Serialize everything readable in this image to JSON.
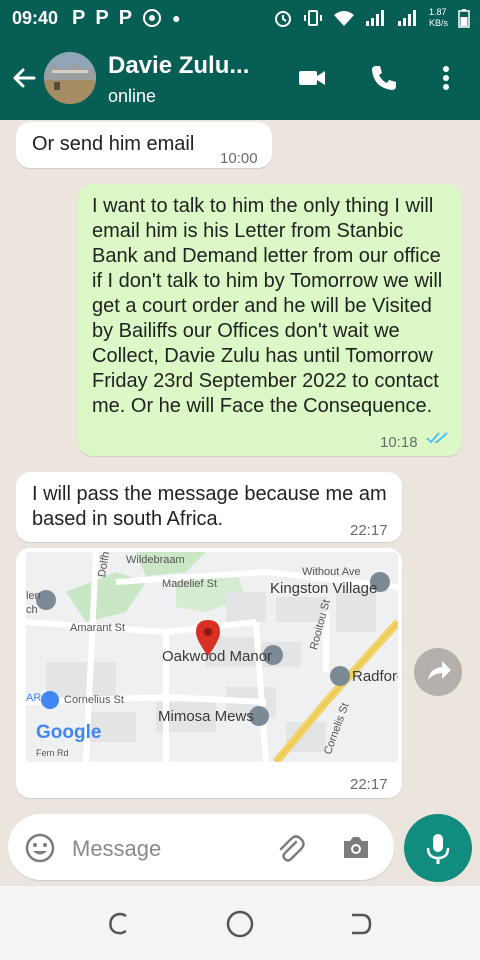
{
  "status_bar": {
    "time": "09:40",
    "speed_top": "1.87",
    "speed_unit": "KB/s"
  },
  "header": {
    "contact_name": "Davie Zulu...",
    "status": "online"
  },
  "messages": [
    {
      "direction": "in",
      "text": "Or send him email",
      "time": "10:00"
    },
    {
      "direction": "out",
      "text": "I want to talk to him the only thing I will email him is his Letter from Stanbic Bank and Demand letter from our office if I don't talk to him by Tomorrow we will get a court order and he will be Visited by Bailiffs our Offices don't wait we Collect, Davie Zulu has until Tomorrow Friday 23rd September 2022 to contact me. Or he will Face the Consequence.",
      "time": "10:18",
      "read": true
    },
    {
      "direction": "in",
      "text": "I will pass the message because me am based in south Africa.",
      "time": "22:17"
    },
    {
      "direction": "in",
      "type": "location",
      "time": "22:17"
    }
  ],
  "map": {
    "labels": [
      "Wildebraam",
      "Madelief St",
      "Without Ave",
      "Kingston Village",
      "Dolfhout St",
      "Amarant St",
      "Oakwood Manor",
      "Rooitou St",
      "Radford",
      "Cornelius St",
      "Mimosa Mews",
      "Cornelis St",
      "Fern Rd",
      "Google",
      "len",
      "ch",
      "AR"
    ]
  },
  "composer": {
    "placeholder": "Message"
  },
  "colors": {
    "header": "#075e54",
    "outgoing": "#dcf8c6",
    "incoming": "#ffffff",
    "accent": "#128c7e",
    "tick": "#4fc3f7"
  },
  "icons": [
    "back-arrow-icon",
    "video-call-icon",
    "phone-icon",
    "more-vert-icon",
    "emoji-icon",
    "attach-icon",
    "camera-icon",
    "mic-icon",
    "share-icon",
    "double-check-icon",
    "map-pin-icon"
  ]
}
